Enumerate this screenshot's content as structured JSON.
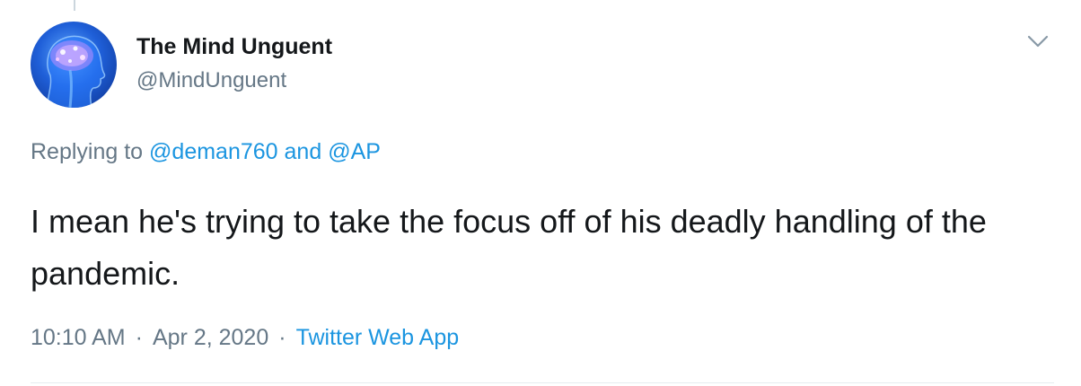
{
  "author": {
    "name": "The Mind Unguent",
    "handle": "@MindUnguent",
    "avatar_icon": "brain-avatar-icon"
  },
  "reply": {
    "prefix": "Replying to",
    "mentions": [
      "@deman760",
      "@AP"
    ],
    "conjunction": "and"
  },
  "tweet": {
    "text": "I mean he's trying to take the focus off of his deadly handling of the pandemic."
  },
  "meta": {
    "time": "10:10 AM",
    "date": "Apr 2, 2020",
    "source": "Twitter Web App",
    "separator": "·"
  },
  "colors": {
    "text": "#14171a",
    "secondary": "#657786",
    "link": "#1b95e0",
    "divider": "#e6ecf0"
  },
  "icons": {
    "more_menu": "chevron-down-icon"
  }
}
